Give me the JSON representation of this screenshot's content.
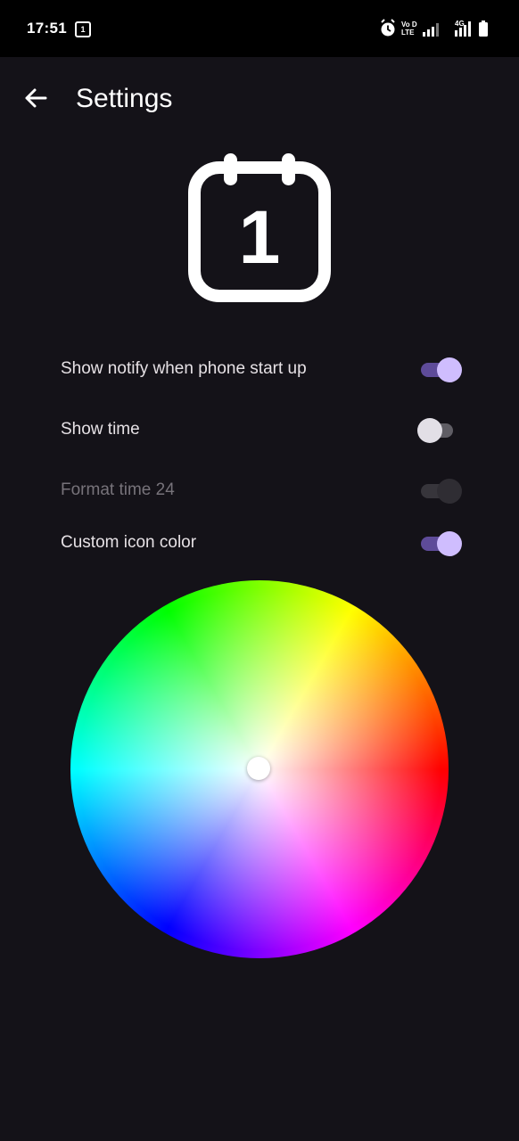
{
  "status_bar": {
    "time": "17:51",
    "calendar_badge": "1",
    "icons": [
      "calendar-icon",
      "alarm-icon",
      "volte-icon",
      "signal-icon",
      "4g-signal-icon",
      "battery-icon"
    ],
    "volte_label": "Vo LTE",
    "network_label": "4G"
  },
  "app_bar": {
    "back_icon": "arrow-left-icon",
    "title": "Settings"
  },
  "header_icon": {
    "name": "calendar-icon",
    "day": "1"
  },
  "settings": [
    {
      "label": "Show notify when phone start up",
      "state": "on",
      "enabled": true
    },
    {
      "label": "Show time",
      "state": "off",
      "enabled": true
    },
    {
      "label": "Format time 24",
      "state": "on",
      "enabled": false
    },
    {
      "label": "Custom icon color",
      "state": "on",
      "enabled": true
    }
  ],
  "color_picker": {
    "type": "hue-saturation-wheel",
    "selected_color": "#ffffff"
  },
  "colors": {
    "background": "#141218",
    "switch_track_on": "#5e4b99",
    "switch_thumb_on": "#cfbdfe",
    "text": "#e6e1e5"
  }
}
